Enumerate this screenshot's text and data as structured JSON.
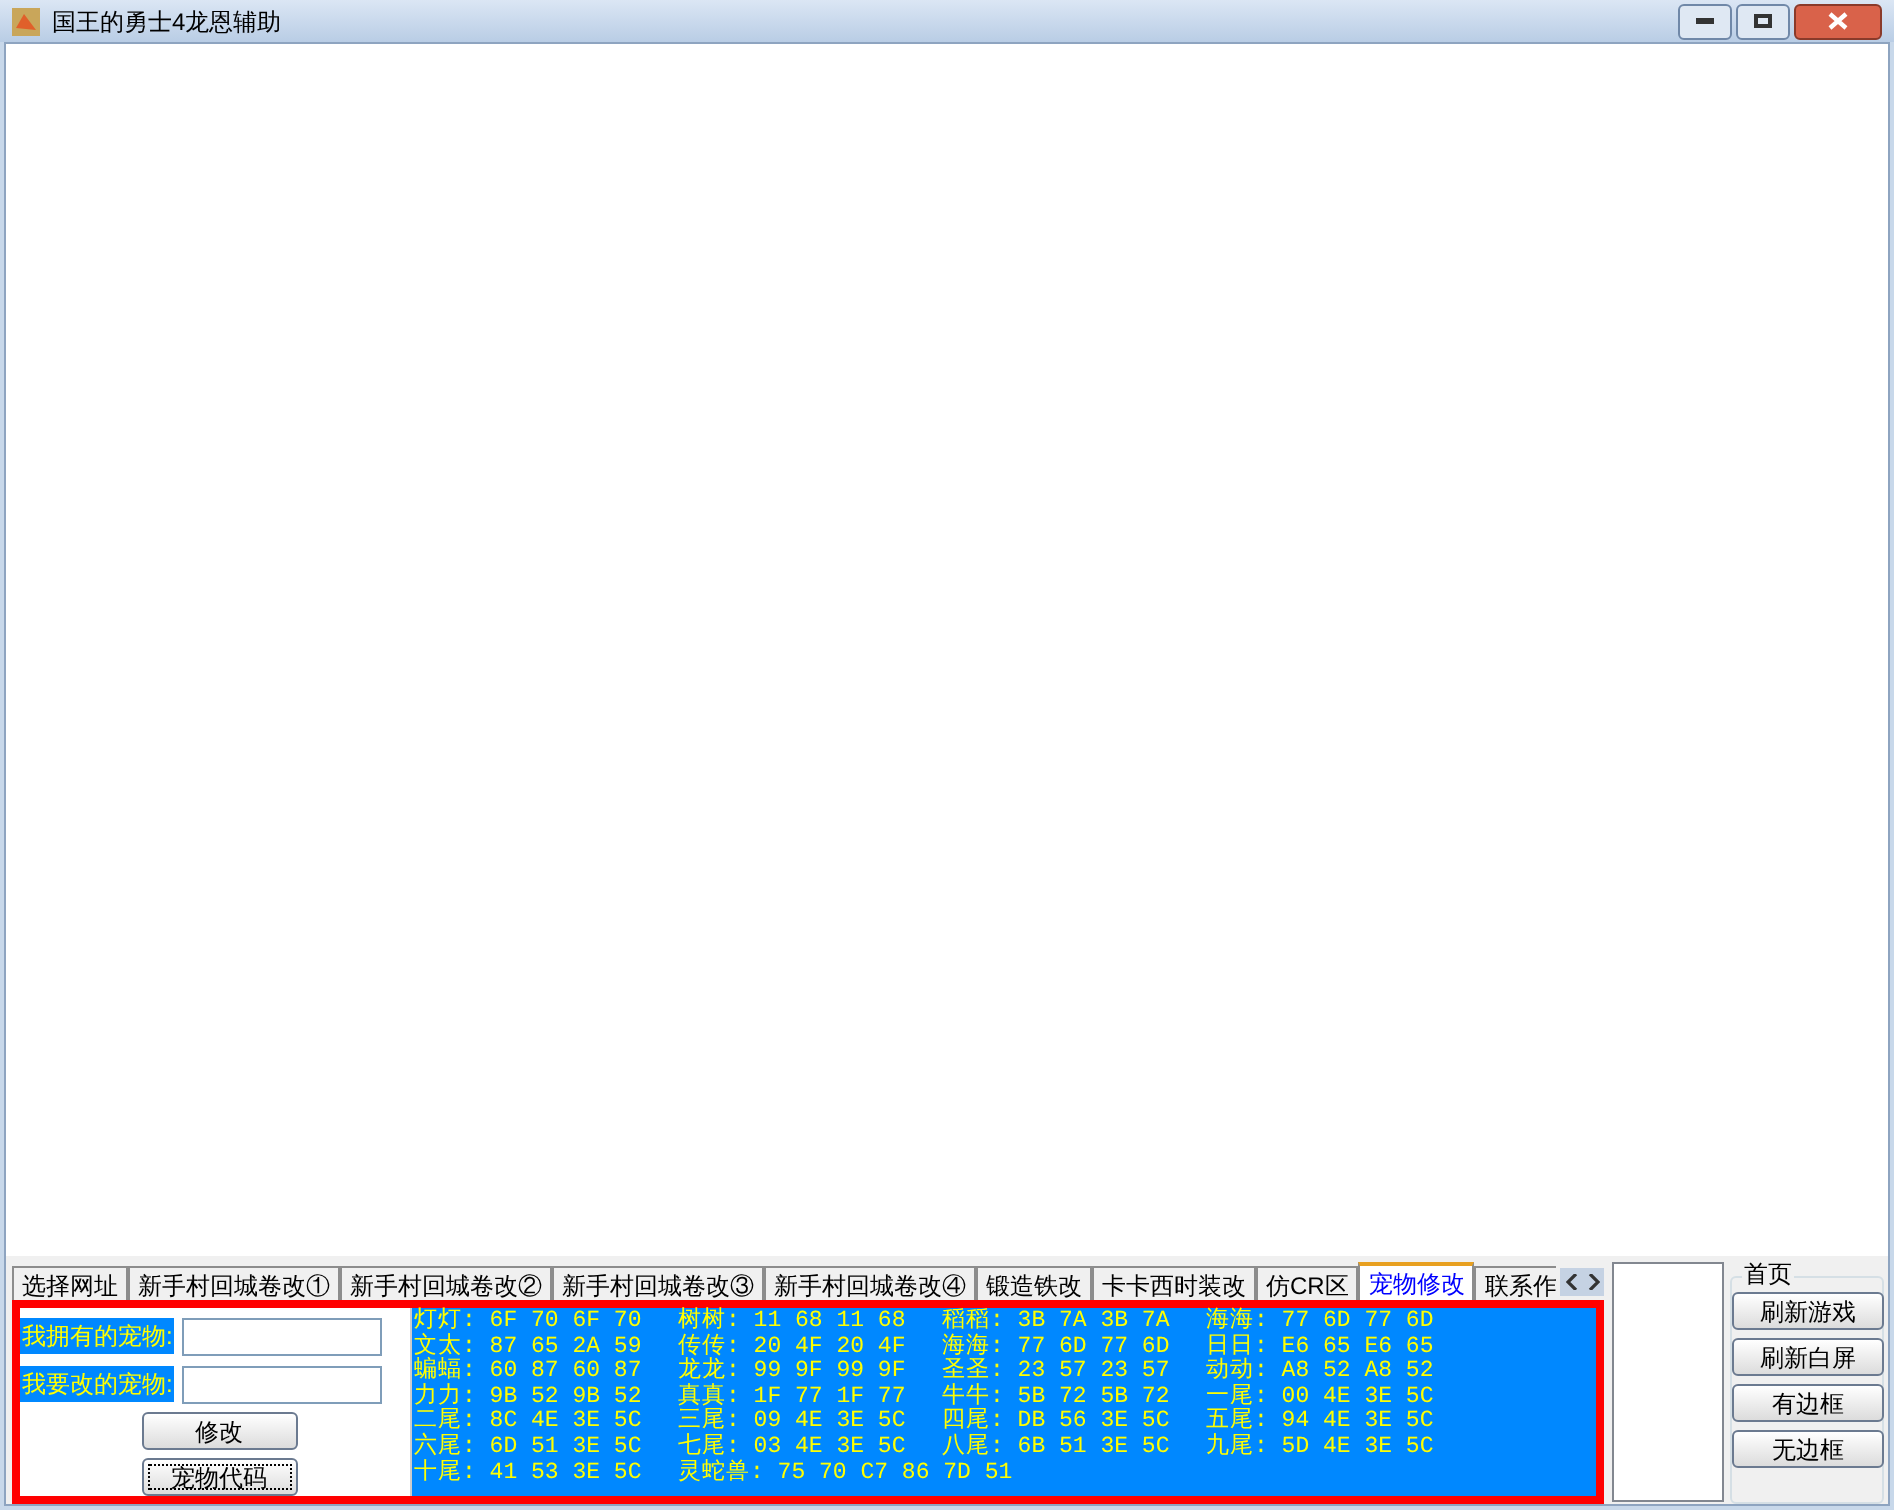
{
  "window": {
    "title": "国王的勇士4龙恩辅助"
  },
  "tabs": [
    {
      "label": "选择网址",
      "selected": false
    },
    {
      "label": "新手村回城卷改①",
      "selected": false
    },
    {
      "label": "新手村回城卷改②",
      "selected": false
    },
    {
      "label": "新手村回城卷改③",
      "selected": false
    },
    {
      "label": "新手村回城卷改④",
      "selected": false
    },
    {
      "label": "锻造铁改",
      "selected": false
    },
    {
      "label": "卡卡西时装改",
      "selected": false
    },
    {
      "label": "仿CR区",
      "selected": false
    },
    {
      "label": "宠物修改",
      "selected": true
    },
    {
      "label": "联系作",
      "selected": false
    }
  ],
  "pet_form": {
    "fields": [
      {
        "label": "我拥有的宠物:"
      },
      {
        "label": "我要改的宠物:"
      }
    ],
    "buttons": [
      {
        "label": "修改",
        "focused": false
      },
      {
        "label": "宠物代码",
        "focused": true
      }
    ]
  },
  "pet_codes": [
    [
      "灯灯: 6F 70 6F 70",
      "树树: 11 68 11 68",
      "稻稻: 3B 7A 3B 7A",
      "海海: 77 6D 77 6D"
    ],
    [
      "文太: 87 65 2A 59",
      "传传: 20 4F 20 4F",
      "海海: 77 6D 77 6D",
      "日日: E6 65 E6 65"
    ],
    [
      "蝙蝠: 60 87 60 87",
      "龙龙: 99 9F 99 9F",
      "圣圣: 23 57 23 57",
      "动动: A8 52 A8 52"
    ],
    [
      "力力: 9B 52 9B 52",
      "真真: 1F 77 1F 77",
      "牛牛: 5B 72 5B 72",
      "一尾: 00 4E 3E 5C"
    ],
    [
      "二尾: 8C 4E 3E 5C",
      "三尾: 09 4E 3E 5C",
      "四尾: DB 56 3E 5C",
      "五尾: 94 4E 3E 5C"
    ],
    [
      "六尾: 6D 51 3E 5C",
      "七尾: 03 4E 3E 5C",
      "八尾: 6B 51 3E 5C",
      "九尾: 5D 4E 3E 5C"
    ],
    [
      "十尾: 41 53 3E 5C",
      "灵蛇兽: 75 70 C7 86 7D 51"
    ]
  ],
  "side_panel": {
    "title": "首页",
    "buttons": [
      "刷新游戏",
      "刷新白屏",
      "有边框",
      "无边框"
    ]
  }
}
